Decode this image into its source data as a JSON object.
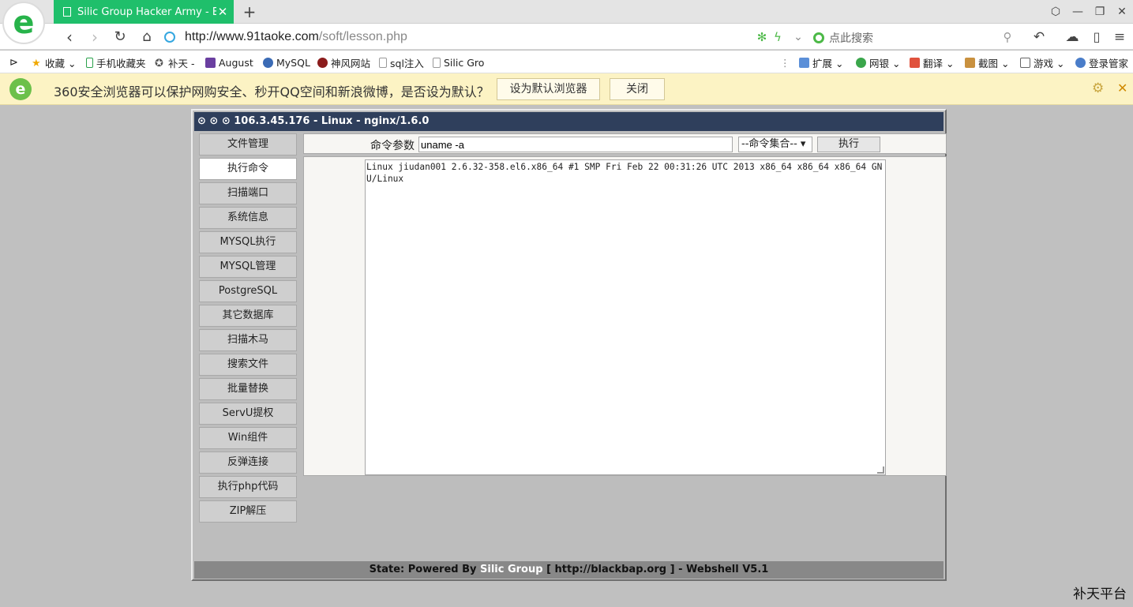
{
  "browser": {
    "tab_title": "Silic Group Hacker Army - Bla",
    "tab_close": "✕",
    "new_tab": "+",
    "window_buttons": {
      "skin": "⬡",
      "minimize": "—",
      "restore": "❐",
      "close": "✕"
    },
    "url_host": "http://www.91taoke.com",
    "url_path": "/soft/lesson.php",
    "search_placeholder": "点此搜索"
  },
  "bookmarks": [
    {
      "label": "收藏 ⌄",
      "icon": "star-icon"
    },
    {
      "label": "手机收藏夹",
      "icon": "phone-icon"
    },
    {
      "label": "补天 -",
      "icon": "butian-icon"
    },
    {
      "label": "August",
      "icon": "august-icon"
    },
    {
      "label": "MySQL",
      "icon": "mysql-icon"
    },
    {
      "label": "神风网站",
      "icon": "shenfeng-icon"
    },
    {
      "label": "sql注入",
      "icon": "page-icon"
    },
    {
      "label": "Silic Gro",
      "icon": "page-icon"
    }
  ],
  "tools": [
    {
      "label": "扩展 ⌄",
      "icon": "extensions-icon"
    },
    {
      "label": "网银 ⌄",
      "icon": "bank-icon"
    },
    {
      "label": "翻译 ⌄",
      "icon": "translate-icon"
    },
    {
      "label": "截图 ⌄",
      "icon": "screenshot-icon"
    },
    {
      "label": "游戏 ⌄",
      "icon": "game-icon"
    },
    {
      "label": "登录管家",
      "icon": "login-icon"
    }
  ],
  "notification": {
    "message": "360安全浏览器可以保护网购安全、秒开QQ空间和新浪微博，是否设为默认？",
    "set_default": "设为默认浏览器",
    "close": "关闭"
  },
  "shell": {
    "header": "⊙ ⊙ ⊙ 106.3.45.176 - Linux - nginx/1.6.0",
    "menu": [
      "文件管理",
      "执行命令",
      "扫描端口",
      "系统信息",
      "MYSQL执行",
      "MYSQL管理",
      "PostgreSQL",
      "其它数据库",
      "扫描木马",
      "搜索文件",
      "批量替换",
      "ServU提权",
      "Win组件",
      "反弹连接",
      "执行php代码",
      "ZIP解压"
    ],
    "active_menu": "执行命令",
    "command_label": "命令参数",
    "command_value": "uname -a",
    "command_set": "--命令集合-- ▾",
    "execute": "执行",
    "output": "Linux jiudan001 2.6.32-358.el6.x86_64 #1 SMP Fri Feb 22 00:31:26 UTC 2013 x86_64 x86_64 x86_64 GNU/Linux",
    "footer_prefix": "State: Powered By ",
    "footer_brand": "Silic Group",
    "footer_suffix": " [ http://blackbap.org ] - Webshell V5.1"
  },
  "watermark": "补天平台",
  "colors": {
    "tab_green": "#1fbf6b",
    "shell_header": "#2f3f5c",
    "notification_bg": "#fcf3c4",
    "page_bg": "#c0c0c0"
  }
}
